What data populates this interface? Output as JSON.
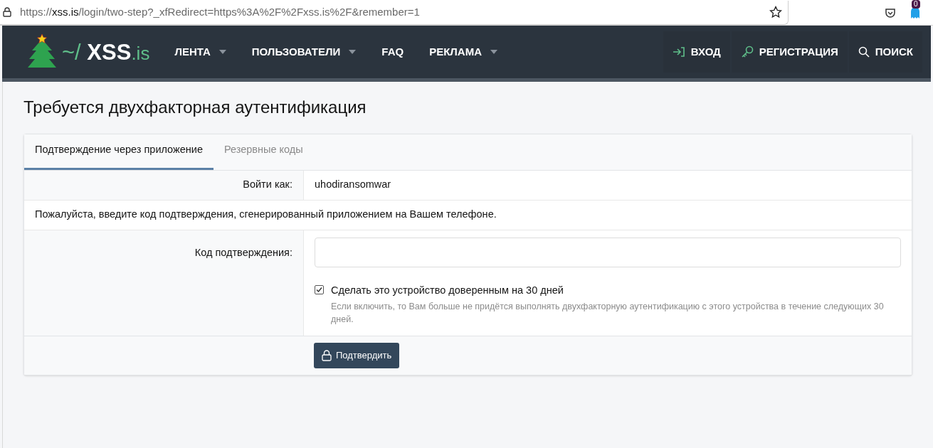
{
  "browser": {
    "url_scheme": "https://",
    "url_host": "xss.is",
    "url_path": "/login/two-step?_xfRedirect=https%3A%2F%2Fxss.is%2F&remember=1",
    "extension_badge": "0"
  },
  "header": {
    "logo_prefix": "~/",
    "logo_name": "XSS",
    "logo_suffix": ".is",
    "nav": [
      {
        "label": "ЛЕНТА",
        "has_menu": true
      },
      {
        "label": "ПОЛЬЗОВАТЕЛИ",
        "has_menu": true
      },
      {
        "label": "FAQ",
        "has_menu": false
      },
      {
        "label": "РЕКЛАМА",
        "has_menu": true
      }
    ],
    "actions": [
      {
        "kind": "login",
        "label": "ВХОД"
      },
      {
        "kind": "register",
        "label": "РЕГИСТРАЦИЯ"
      },
      {
        "kind": "search",
        "label": "ПОИСК"
      }
    ]
  },
  "page_title": "Требуется двухфакторная аутентификация",
  "tabs": [
    {
      "label": "Подтверждение через приложение",
      "selected": true
    },
    {
      "label": "Резервные коды",
      "selected": false
    }
  ],
  "login_as": {
    "label": "Войти как:",
    "value": "uhodiransomwar"
  },
  "instructions": "Пожалуйста, введите код подтверждения, сгенерированный приложением на Вашем телефоне.",
  "code_field": {
    "label": "Код подтверждения:"
  },
  "trust_device": {
    "label": "Сделать это устройство доверенным на 30 дней",
    "checked": true,
    "hint": "Если включить, то Вам больше не придётся выполнять двухфакторную аутентификацию с этого устройства в течение следующих 30 дней."
  },
  "submit": "Подтвердить"
}
